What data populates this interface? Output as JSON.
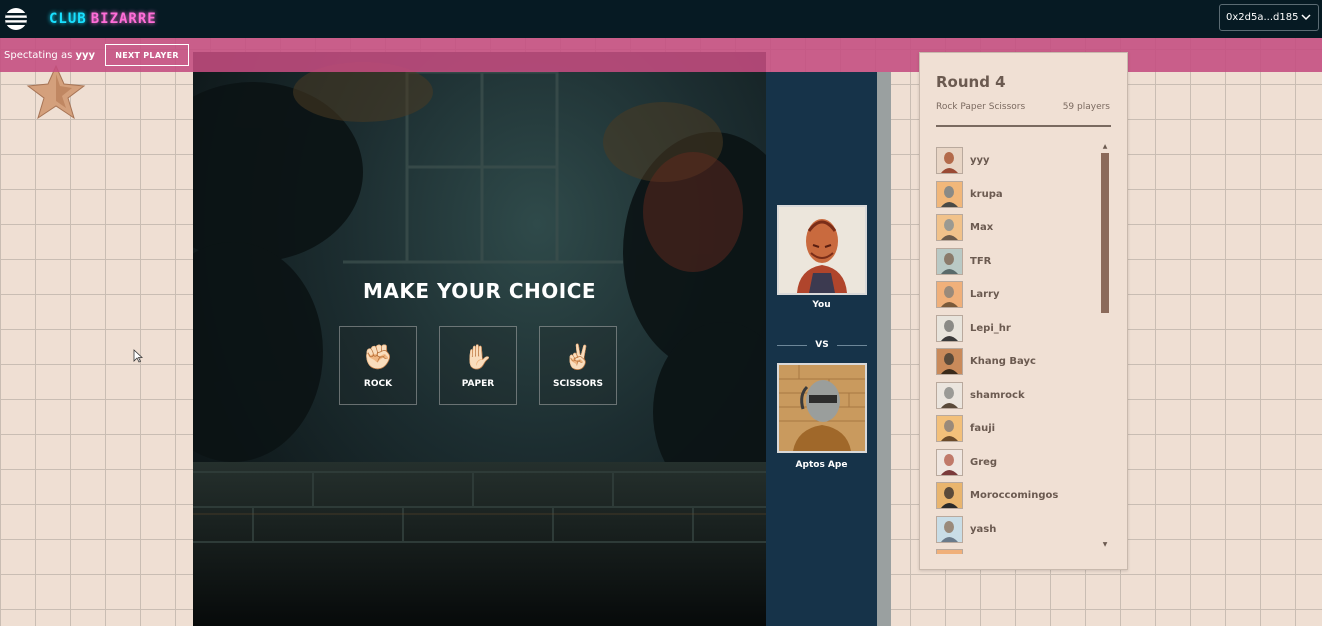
{
  "header": {
    "logo_club": "CLUB",
    "logo_bizarre": "BIZARRE",
    "wallet_address": "0x2d5a...d185"
  },
  "spectate": {
    "prefix": "Spectating as",
    "user": "yyy",
    "next_button": "NEXT PLAYER"
  },
  "game": {
    "prompt": "MAKE YOUR CHOICE",
    "choices": [
      {
        "label": "ROCK",
        "icon": "rock-hand-icon"
      },
      {
        "label": "PAPER",
        "icon": "paper-hand-icon"
      },
      {
        "label": "SCISSORS",
        "icon": "scissors-hand-icon"
      }
    ],
    "player_you": "You",
    "vs": "VS",
    "opponent": "Aptos Ape"
  },
  "leaderboard": {
    "round": "Round 4",
    "game_name": "Rock Paper Scissors",
    "player_count": "59 players",
    "players": [
      "yyy",
      "krupa",
      "Max",
      "TFR",
      "Larry",
      "Lepi_hr",
      "Khang Bayc",
      "shamrock",
      "fauji",
      "Greg",
      "Moroccomingos",
      "yash"
    ]
  },
  "colors": {
    "accent_pink": "#c44c80",
    "header_bg": "#061a23",
    "side_panel": "#163349",
    "board_text": "#6b5a50"
  }
}
